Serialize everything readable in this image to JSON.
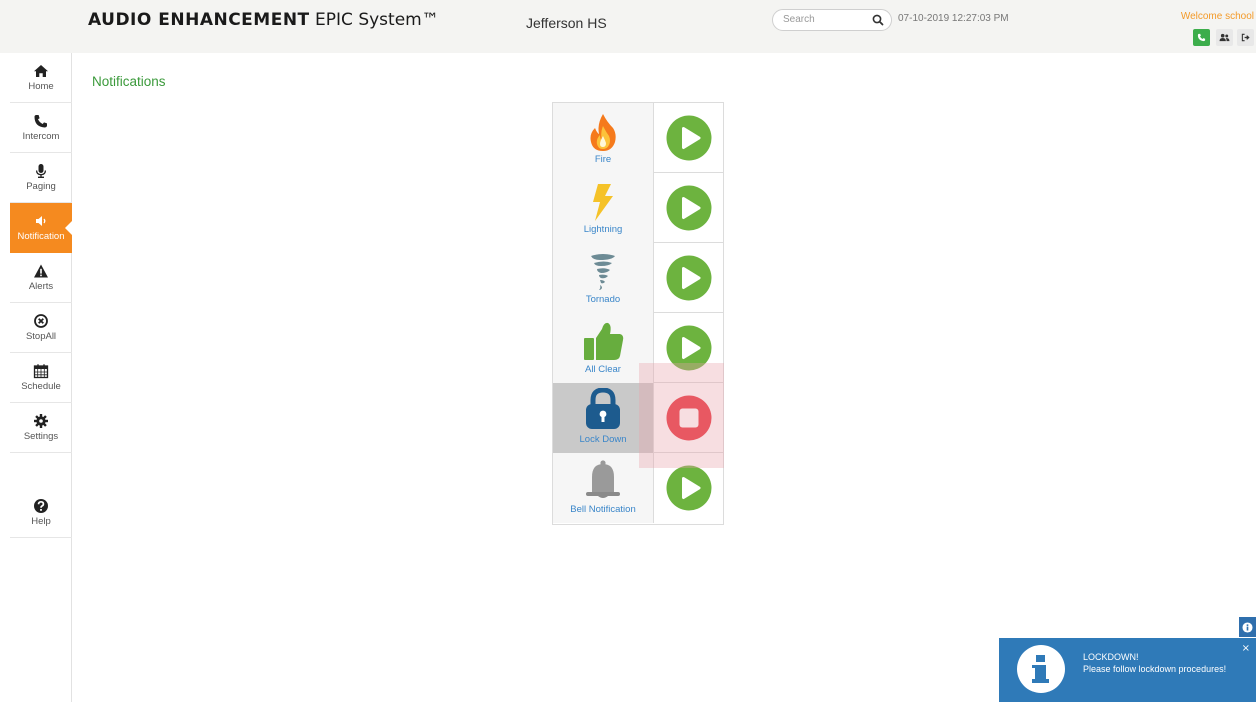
{
  "header": {
    "brand_bold": "AUDIO ENHANCEMENT",
    "brand_rest": " EPIC System™",
    "school": "Jefferson HS",
    "search_placeholder": "Search",
    "datetime": "07-10-2019 12:27:03 PM",
    "welcome": "Welcome school"
  },
  "sidebar": {
    "items": [
      {
        "label": "Home",
        "icon": "home-icon"
      },
      {
        "label": "Intercom",
        "icon": "phone-icon"
      },
      {
        "label": "Paging",
        "icon": "microphone-icon"
      },
      {
        "label": "Notification",
        "icon": "speaker-icon",
        "active": true
      },
      {
        "label": "Alerts",
        "icon": "warning-icon"
      },
      {
        "label": "StopAll",
        "icon": "stop-circle-icon"
      },
      {
        "label": "Schedule",
        "icon": "calendar-icon"
      },
      {
        "label": "Settings",
        "icon": "gear-icon"
      },
      {
        "label": "Help",
        "icon": "question-circle-icon"
      }
    ]
  },
  "main": {
    "title": "Notifications",
    "notifications": [
      {
        "label": "Fire",
        "icon": "fire-icon",
        "state": "play"
      },
      {
        "label": "Lightning",
        "icon": "lightning-icon",
        "state": "play"
      },
      {
        "label": "Tornado",
        "icon": "tornado-icon",
        "state": "play"
      },
      {
        "label": "All Clear",
        "icon": "thumbs-up-icon",
        "state": "play"
      },
      {
        "label": "Lock Down",
        "icon": "lock-icon",
        "state": "stop"
      },
      {
        "label": "Bell Notification",
        "icon": "bell-icon",
        "state": "play"
      }
    ]
  },
  "toast": {
    "title": "LOCKDOWN!",
    "message": "Please follow lockdown procedures!",
    "close": "×"
  },
  "colors": {
    "accent_orange": "#f58a1f",
    "title_green": "#3b9a3b",
    "play_green": "#6db33f",
    "stop_red": "#e8323c",
    "toast_blue": "#2f7ab8",
    "label_blue": "#3a86c9"
  }
}
